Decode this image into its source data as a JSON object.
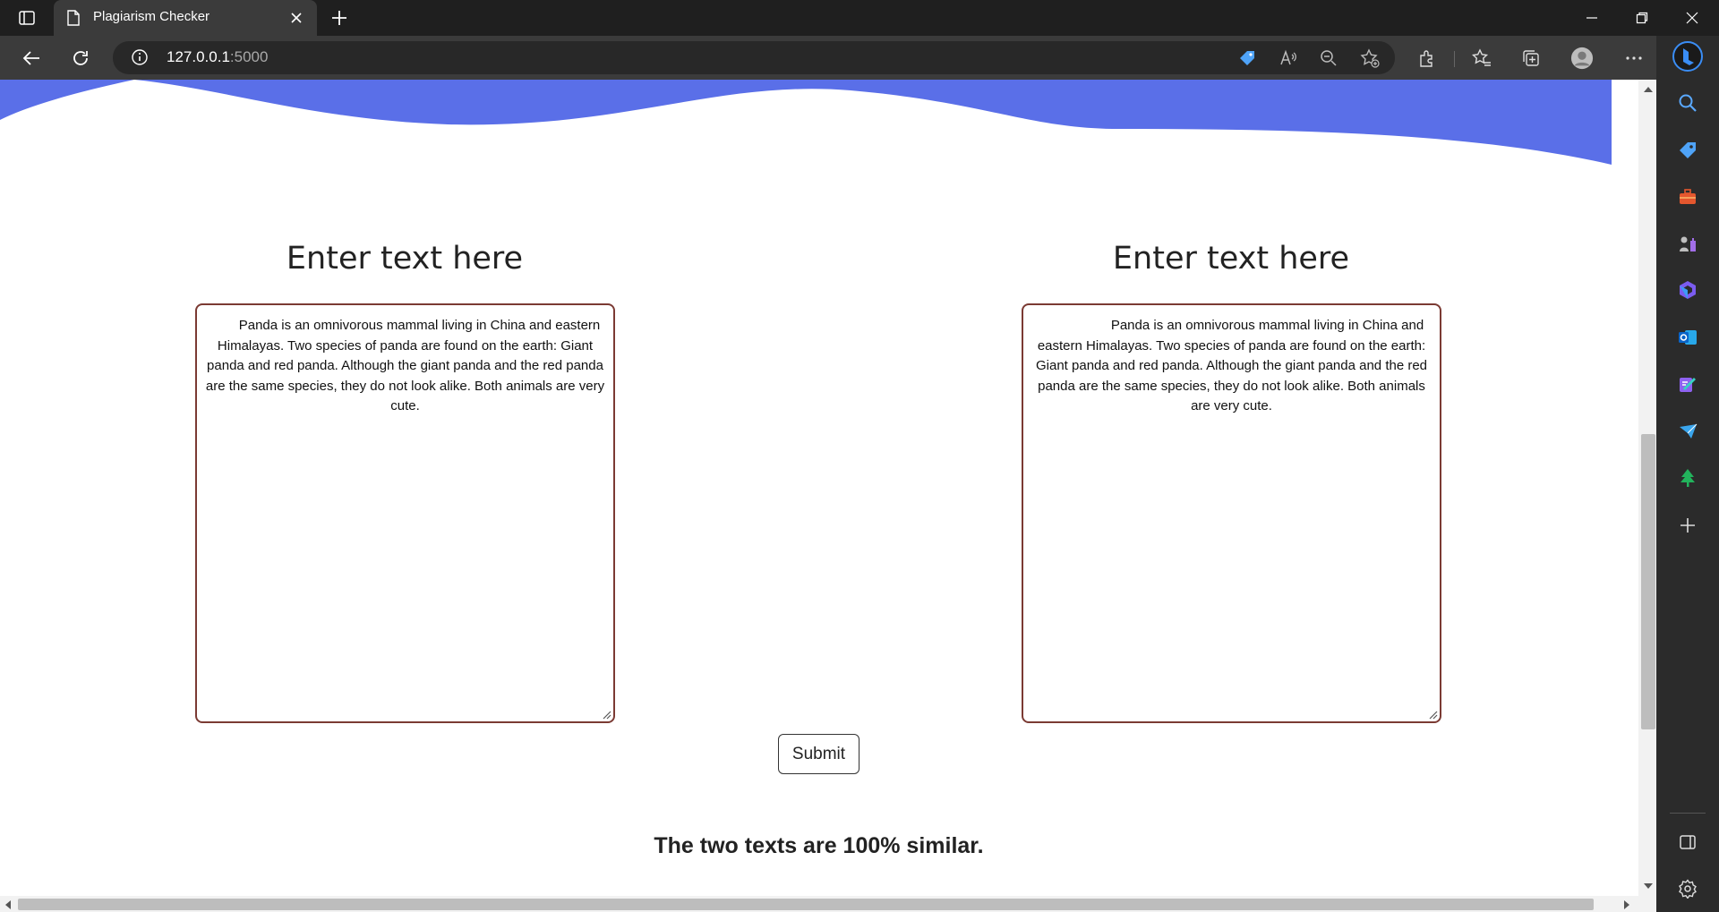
{
  "browser": {
    "tab_title": "Plagiarism Checker",
    "url_host": "127.0.0.1",
    "url_port": ":5000"
  },
  "page": {
    "left_heading": "Enter text here",
    "right_heading": "Enter text here",
    "left_text": "Panda is an omnivorous mammal living in China and eastern Himalayas. Two species of panda are found on the earth: Giant panda and red panda. Although the giant panda and the red panda are the same species, they do not look alike. Both animals are very cute.",
    "right_text": "Panda is an omnivorous mammal living in China and eastern Himalayas. Two species of panda are found on the earth: Giant panda and red panda. Although the giant panda and the red panda are the same species, they do not look alike. Both animals are very cute.",
    "submit_label": "Submit",
    "result": "The two texts are 100% similar."
  },
  "colors": {
    "wave": "#5a6fe8",
    "textbox_border": "#7b3a33"
  },
  "icons": {
    "toolbar": [
      "shopping-tag-icon",
      "read-aloud-icon",
      "zoom-out-icon",
      "add-favorite-icon",
      "extensions-icon",
      "favorites-icon",
      "collections-icon",
      "profile-icon",
      "more-icon",
      "copilot-icon"
    ],
    "sidebar": [
      "search-icon",
      "shopping-icon",
      "tools-icon",
      "games-icon",
      "microsoft365-icon",
      "outlook-icon",
      "designer-icon",
      "telegram-icon",
      "tree-icon",
      "add-icon",
      "split-screen-icon",
      "settings-icon"
    ]
  }
}
